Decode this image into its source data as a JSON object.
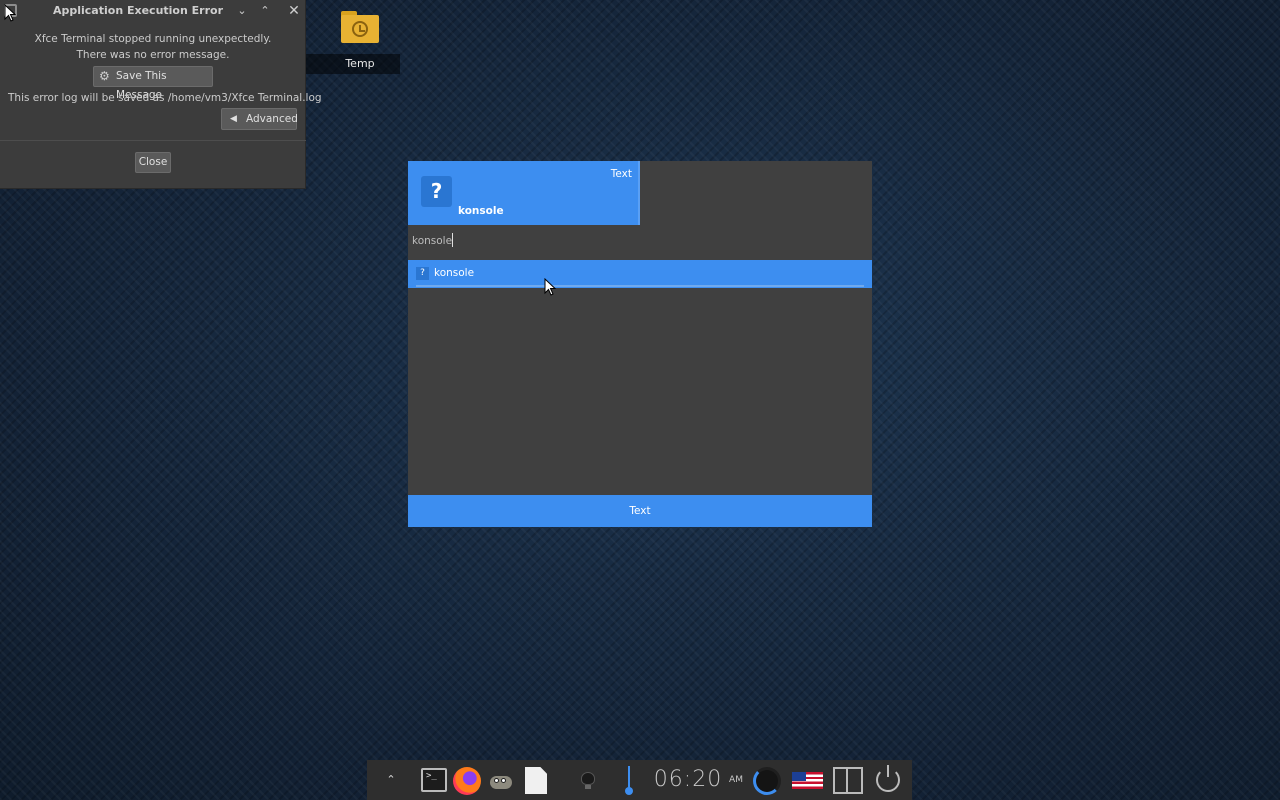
{
  "error_dialog": {
    "title": "Application Execution Error",
    "message_line1": "Xfce Terminal stopped running unexpectedly.",
    "message_line2": "There was no error message.",
    "save_button": "Save This Message",
    "log_text": "This error log will be saved as /home/vm3/Xfce Terminal.log",
    "advanced_button": "Advanced",
    "close_button": "Close",
    "icons": {
      "save": "gear-icon",
      "advanced": "chevron-left-icon",
      "window_close": "close-icon"
    }
  },
  "desktop": {
    "icons": [
      {
        "label": "Temp",
        "icon": "folder-recent-icon"
      }
    ]
  },
  "launcher": {
    "card_type": "Text",
    "card_name": "konsole",
    "query": "konsole",
    "results": [
      {
        "name": "konsole",
        "icon": "unknown-app-icon"
      }
    ],
    "footer": "Text",
    "accent_color": "#3d8ef0"
  },
  "panel": {
    "clock_time": "06:20",
    "clock_ampm": "AM",
    "items": [
      "show-hidden-icon",
      "terminal-icon",
      "firefox-icon",
      "gimp-icon",
      "document-icon",
      "bulb-icon",
      "volume-icon",
      "clock",
      "network-ring-icon",
      "us-flag-icon",
      "workspace-icon",
      "power-icon"
    ]
  }
}
